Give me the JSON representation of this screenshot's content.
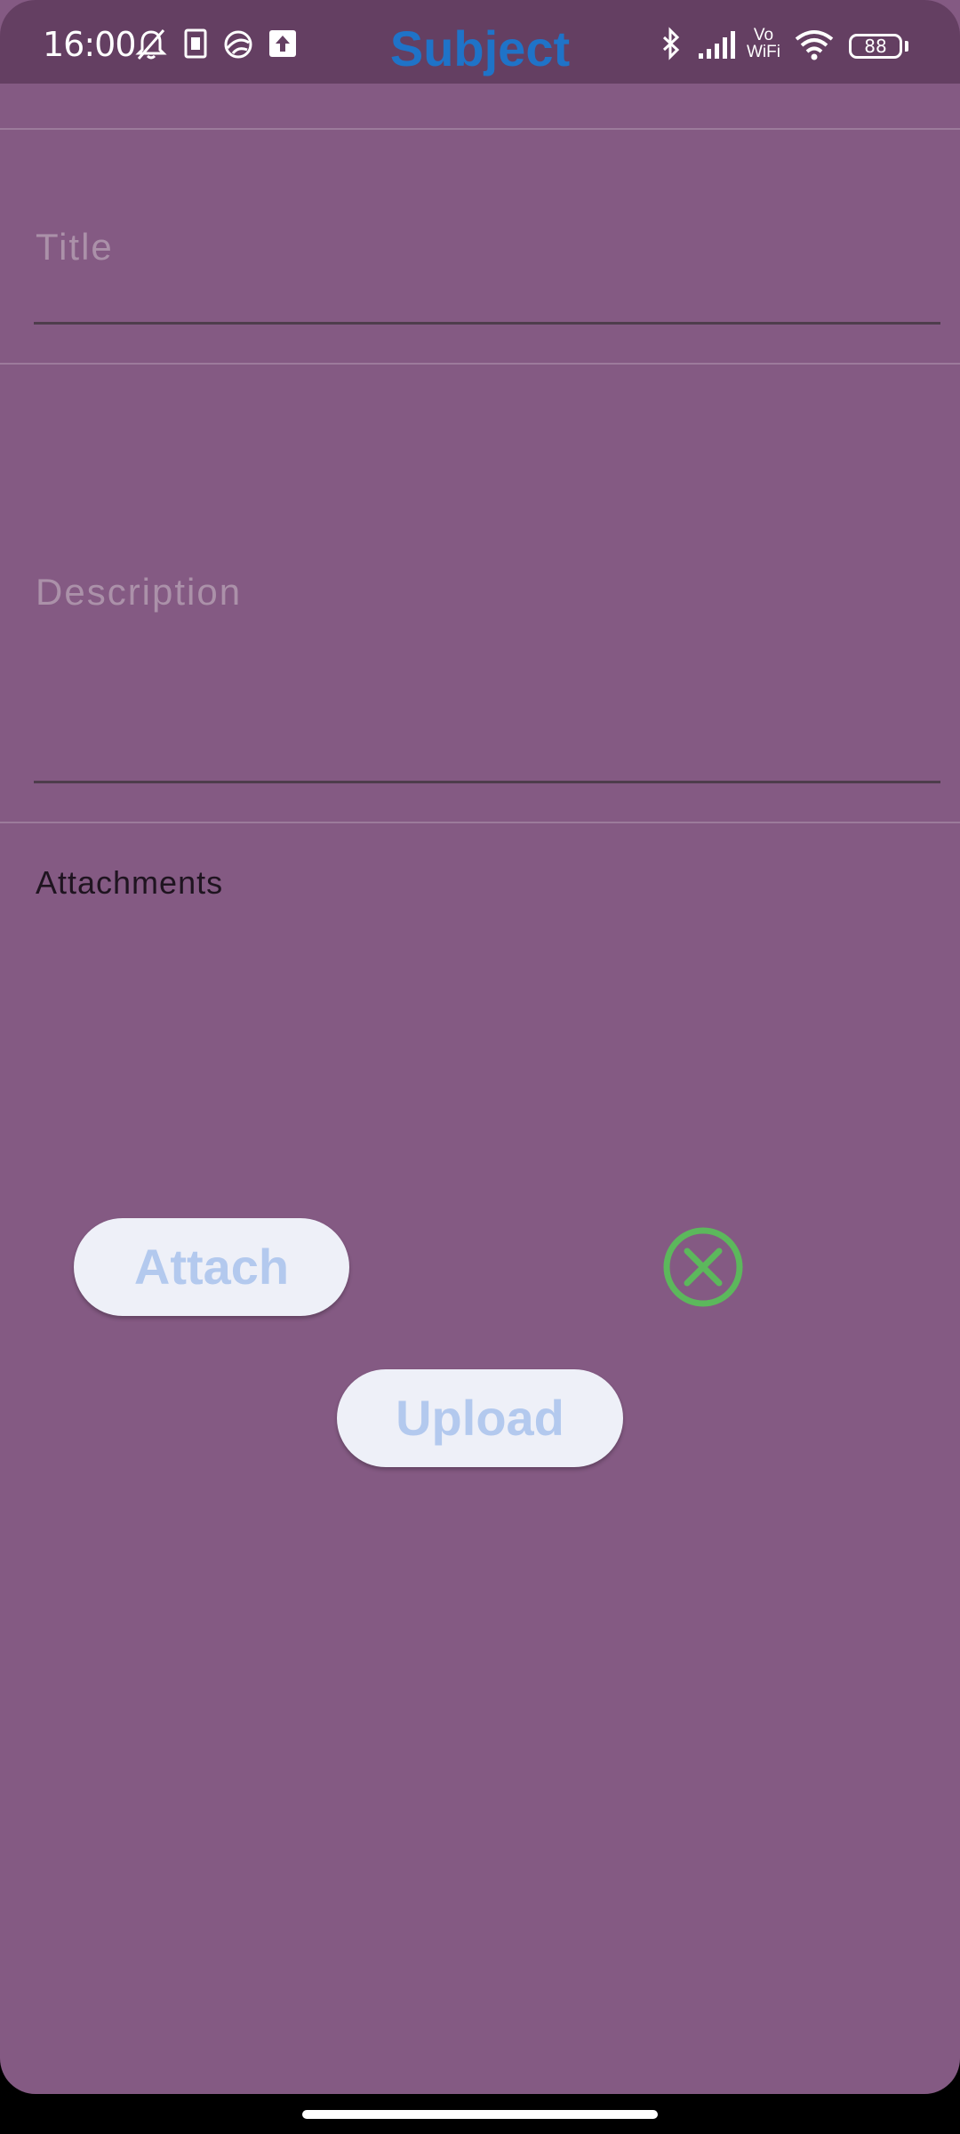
{
  "status_bar": {
    "time": "16:00",
    "battery": "88",
    "icons": [
      "bell-off-icon",
      "sim-icon",
      "vpn-icon",
      "upload-icon",
      "bluetooth-icon",
      "signal-icon",
      "vowifi-icon",
      "wifi-icon",
      "battery-icon"
    ],
    "vowifi_line1": "Vo",
    "vowifi_line2": "WiFi"
  },
  "app_bar": {
    "title": "Subject"
  },
  "form": {
    "title_placeholder": "Title",
    "description_placeholder": "Description",
    "attachments_label": "Attachments"
  },
  "actions": {
    "attach_label": "Attach",
    "upload_label": "Upload",
    "clear_icon": "close-circle-icon"
  },
  "colors": {
    "background": "#845a83",
    "status_bar": "#643f62",
    "title": "#1f73c8",
    "button_bg": "#eef0f8",
    "button_text": "#b3c9ee",
    "clear_icon": "#5cb85c"
  }
}
